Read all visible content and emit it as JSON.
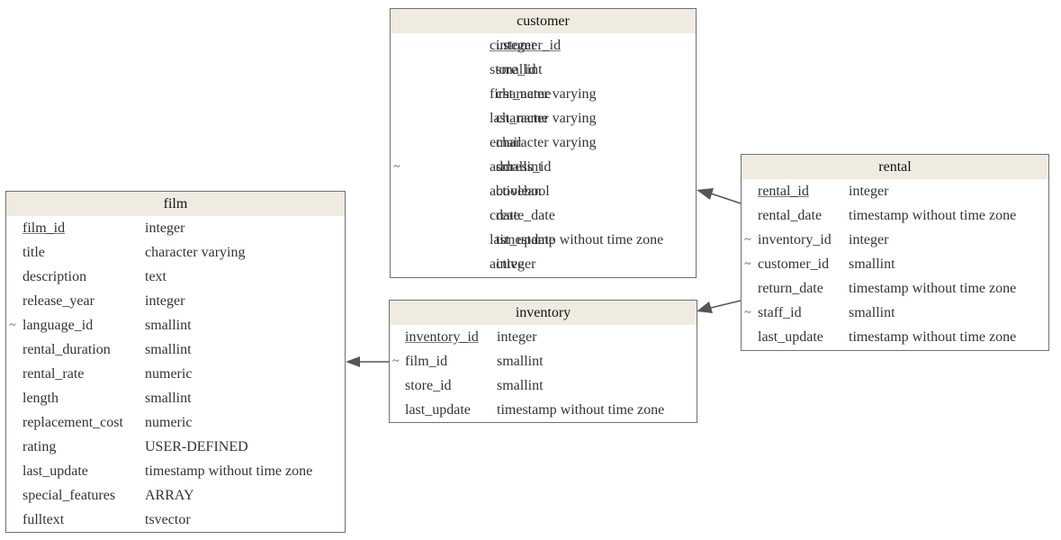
{
  "tables": {
    "customer": {
      "name": "customer",
      "columns": [
        {
          "name": "customer_id",
          "type": "integer",
          "pk": true,
          "fk": false
        },
        {
          "name": "store_id",
          "type": "smallint",
          "pk": false,
          "fk": false
        },
        {
          "name": "first_name",
          "type": "character varying",
          "pk": false,
          "fk": false
        },
        {
          "name": "last_name",
          "type": "character varying",
          "pk": false,
          "fk": false
        },
        {
          "name": "email",
          "type": "character varying",
          "pk": false,
          "fk": false
        },
        {
          "name": "address_id",
          "type": "smallint",
          "pk": false,
          "fk": true
        },
        {
          "name": "activebool",
          "type": "boolean",
          "pk": false,
          "fk": false
        },
        {
          "name": "create_date",
          "type": "date",
          "pk": false,
          "fk": false
        },
        {
          "name": "last_update",
          "type": "timestamp without time zone",
          "pk": false,
          "fk": false
        },
        {
          "name": "active",
          "type": "integer",
          "pk": false,
          "fk": false
        }
      ]
    },
    "film": {
      "name": "film",
      "columns": [
        {
          "name": "film_id",
          "type": "integer",
          "pk": true,
          "fk": false
        },
        {
          "name": "title",
          "type": "character varying",
          "pk": false,
          "fk": false
        },
        {
          "name": "description",
          "type": "text",
          "pk": false,
          "fk": false
        },
        {
          "name": "release_year",
          "type": "integer",
          "pk": false,
          "fk": false
        },
        {
          "name": "language_id",
          "type": "smallint",
          "pk": false,
          "fk": true
        },
        {
          "name": "rental_duration",
          "type": "smallint",
          "pk": false,
          "fk": false
        },
        {
          "name": "rental_rate",
          "type": "numeric",
          "pk": false,
          "fk": false
        },
        {
          "name": "length",
          "type": "smallint",
          "pk": false,
          "fk": false
        },
        {
          "name": "replacement_cost",
          "type": "numeric",
          "pk": false,
          "fk": false
        },
        {
          "name": "rating",
          "type": "USER-DEFINED",
          "pk": false,
          "fk": false
        },
        {
          "name": "last_update",
          "type": "timestamp without time zone",
          "pk": false,
          "fk": false
        },
        {
          "name": "special_features",
          "type": "ARRAY",
          "pk": false,
          "fk": false
        },
        {
          "name": "fulltext",
          "type": "tsvector",
          "pk": false,
          "fk": false
        }
      ]
    },
    "inventory": {
      "name": "inventory",
      "columns": [
        {
          "name": "inventory_id",
          "type": "integer",
          "pk": true,
          "fk": false
        },
        {
          "name": "film_id",
          "type": "smallint",
          "pk": false,
          "fk": true
        },
        {
          "name": "store_id",
          "type": "smallint",
          "pk": false,
          "fk": false
        },
        {
          "name": "last_update",
          "type": "timestamp without time zone",
          "pk": false,
          "fk": false
        }
      ]
    },
    "rental": {
      "name": "rental",
      "columns": [
        {
          "name": "rental_id",
          "type": "integer",
          "pk": true,
          "fk": false
        },
        {
          "name": "rental_date",
          "type": "timestamp without time zone",
          "pk": false,
          "fk": false
        },
        {
          "name": "inventory_id",
          "type": "integer",
          "pk": false,
          "fk": true
        },
        {
          "name": "customer_id",
          "type": "smallint",
          "pk": false,
          "fk": true
        },
        {
          "name": "return_date",
          "type": "timestamp without time zone",
          "pk": false,
          "fk": false
        },
        {
          "name": "staff_id",
          "type": "smallint",
          "pk": false,
          "fk": true
        },
        {
          "name": "last_update",
          "type": "timestamp without time zone",
          "pk": false,
          "fk": false
        }
      ]
    }
  },
  "relationships": [
    {
      "from": "rental",
      "to": "customer"
    },
    {
      "from": "rental",
      "to": "inventory"
    },
    {
      "from": "inventory",
      "to": "film"
    }
  ],
  "fk_marker": "~",
  "colors": {
    "header_bg": "#efebe0",
    "border": "#6f6f6f",
    "edge": "#555555",
    "text": "#333333"
  }
}
